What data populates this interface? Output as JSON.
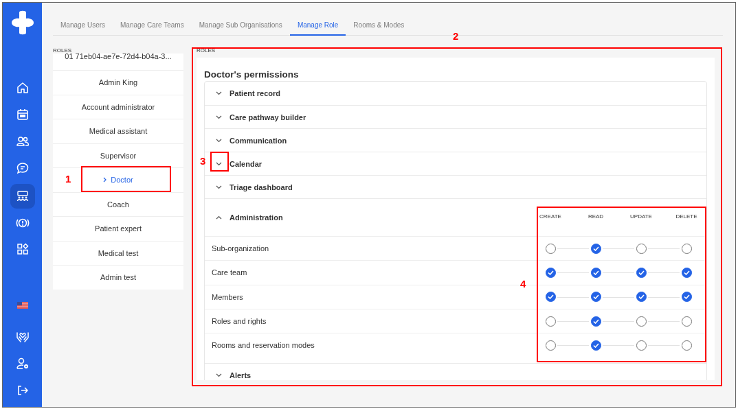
{
  "sidebar": {
    "items": [
      {
        "kind": "home",
        "selected": false
      },
      {
        "kind": "calendar",
        "selected": false
      },
      {
        "kind": "users",
        "selected": false
      },
      {
        "kind": "chat",
        "selected": false
      },
      {
        "kind": "team",
        "selected": true
      },
      {
        "kind": "alert",
        "selected": false
      },
      {
        "kind": "apps",
        "selected": false
      },
      {
        "kind": "flag",
        "selected": false
      },
      {
        "kind": "care",
        "selected": false
      },
      {
        "kind": "user-settings",
        "selected": false
      },
      {
        "kind": "logout",
        "selected": false
      }
    ]
  },
  "tabs": [
    {
      "label": "Manage Users",
      "selected": false
    },
    {
      "label": "Manage Care Teams",
      "selected": false
    },
    {
      "label": "Manage Sub Organisations",
      "selected": false
    },
    {
      "label": "Manage Role",
      "selected": true
    },
    {
      "label": "Rooms & Modes",
      "selected": false
    }
  ],
  "roles": {
    "label": "ROLES",
    "items": [
      {
        "name": "01 71eb04-ae7e-72d4-b04a-3...",
        "selected": false
      },
      {
        "name": "Admin King",
        "selected": false
      },
      {
        "name": "Account administrator",
        "selected": false
      },
      {
        "name": "Medical assistant",
        "selected": false
      },
      {
        "name": "Supervisor",
        "selected": false
      },
      {
        "name": "Doctor",
        "selected": true
      },
      {
        "name": "Coach",
        "selected": false
      },
      {
        "name": "Patient expert",
        "selected": false
      },
      {
        "name": "Medical test",
        "selected": false
      },
      {
        "name": "Admin test",
        "selected": false
      }
    ]
  },
  "permissions": {
    "label": "ROLES",
    "title": "Doctor's permissions",
    "sections": [
      {
        "title": "Patient record",
        "expanded": false
      },
      {
        "title": "Care pathway builder",
        "expanded": false
      },
      {
        "title": "Communication",
        "expanded": false
      },
      {
        "title": "Calendar",
        "expanded": false
      },
      {
        "title": "Triage dashboard",
        "expanded": false
      },
      {
        "title": "Administration",
        "expanded": true,
        "columns": [
          "CREATE",
          "READ",
          "UPDATE",
          "DELETE"
        ],
        "rows": [
          {
            "label": "Sub-organization",
            "checks": [
              {
                "checked": false
              },
              {
                "checked": true
              },
              {
                "checked": false
              },
              {
                "checked": false
              }
            ]
          },
          {
            "label": "Care team",
            "checks": [
              {
                "checked": true
              },
              {
                "checked": true
              },
              {
                "checked": true
              },
              {
                "checked": true
              }
            ]
          },
          {
            "label": "Members",
            "checks": [
              {
                "checked": true
              },
              {
                "checked": true
              },
              {
                "checked": true
              },
              {
                "checked": true
              }
            ]
          },
          {
            "label": "Roles and rights",
            "checks": [
              {
                "checked": false
              },
              {
                "checked": true
              },
              {
                "checked": false
              },
              {
                "checked": false
              }
            ]
          },
          {
            "label": "Rooms and reservation modes",
            "checks": [
              {
                "checked": false
              },
              {
                "checked": true
              },
              {
                "checked": false
              },
              {
                "checked": false
              }
            ]
          }
        ]
      },
      {
        "title": "Alerts",
        "expanded": false
      }
    ]
  },
  "annotations": [
    {
      "label": "1"
    },
    {
      "label": "2"
    },
    {
      "label": "3"
    },
    {
      "label": "4"
    }
  ]
}
